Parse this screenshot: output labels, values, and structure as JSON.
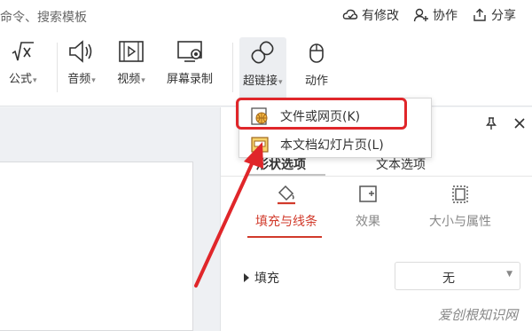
{
  "topbar": {
    "search_hint": "命令、搜索模板",
    "actions": [
      {
        "label": "有修改",
        "icon": "cloud-check-icon"
      },
      {
        "label": "协作",
        "icon": "add-user-icon"
      },
      {
        "label": "分享",
        "icon": "share-icon"
      }
    ]
  },
  "ribbon": {
    "formula": "公式",
    "audio": "音频",
    "video": "视频",
    "screen_record": "屏幕录制",
    "hyperlink": "超链接",
    "animation": "动作"
  },
  "dropdown": {
    "items": [
      {
        "label": "文件或网页(K)",
        "icon": "web-file-icon"
      },
      {
        "label": "本文档幻灯片页(L)",
        "icon": "slide-icon"
      }
    ]
  },
  "pane": {
    "tabs": [
      "形状选项",
      "文本选项"
    ],
    "subtabs": [
      "填充与线条",
      "效果",
      "大小与属性"
    ],
    "fill_label": "填充",
    "fill_value": "无"
  },
  "watermark": "爱创根知识网",
  "colors": {
    "accent_red": "#d13a2b",
    "highlight_red": "#e0262a"
  }
}
